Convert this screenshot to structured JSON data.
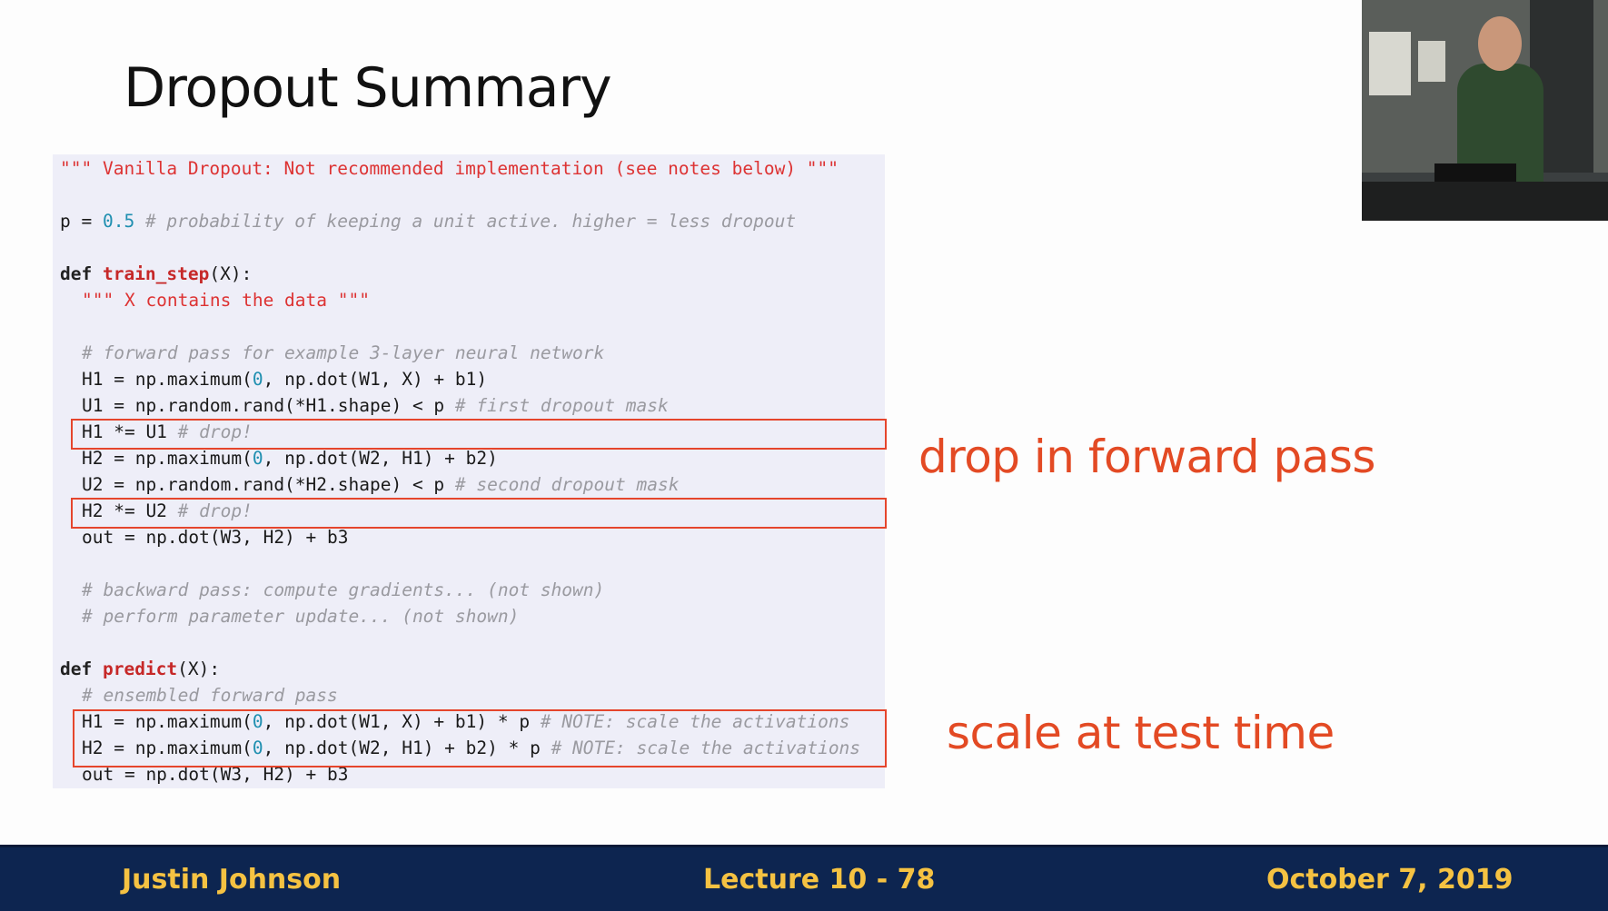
{
  "slide": {
    "title": "Dropout Summary",
    "annotations": {
      "forward": "drop in forward pass",
      "test": "scale at test time"
    }
  },
  "code": {
    "docstring_top": "\"\"\" Vanilla Dropout: Not recommended implementation (see notes below) \"\"\"",
    "p_assign": "p = ",
    "p_value": "0.5",
    "p_comment": " # probability of keeping a unit active. higher = less dropout",
    "def_kw": "def ",
    "train_fn": "train_step",
    "train_sig": "(X):",
    "train_doc": "\"\"\" X contains the data \"\"\"",
    "fwd_comment": "# forward pass for example 3-layer neural network",
    "h1_pre": "H1 = np.maximum(",
    "zero": "0",
    "h1_post": ", np.dot(W1, X) + b1)",
    "u1_code": "U1 = np.random.rand(*H1.shape) < p ",
    "u1_comment": "# first dropout mask",
    "h1_drop_code": "H1 *= U1 ",
    "drop_comment": "# drop!",
    "h2_pre": "H2 = np.maximum(",
    "h2_post": ", np.dot(W2, H1) + b2)",
    "u2_code": "U2 = np.random.rand(*H2.shape) < p ",
    "u2_comment": "# second dropout mask",
    "h2_drop_code": "H2 *= U2 ",
    "out_code": "out = np.dot(W3, H2) + b3",
    "bwd_comment": "# backward pass: compute gradients... (not shown)",
    "upd_comment": "# perform parameter update... (not shown)",
    "predict_fn": "predict",
    "predict_sig": "(X):",
    "ens_comment": "# ensembled forward pass",
    "p_h1_post": ", np.dot(W1, X) + b1) * p ",
    "p_h2_post": ", np.dot(W2, H1) + b2) * p ",
    "note_comment": "# NOTE: scale the activations"
  },
  "footer": {
    "author": "Justin Johnson",
    "lecture": "Lecture 10 - 78",
    "date": "October 7, 2019"
  },
  "colors": {
    "accent": "#e34a24",
    "footer_bg": "#0d2550",
    "footer_text": "#f5c242"
  }
}
